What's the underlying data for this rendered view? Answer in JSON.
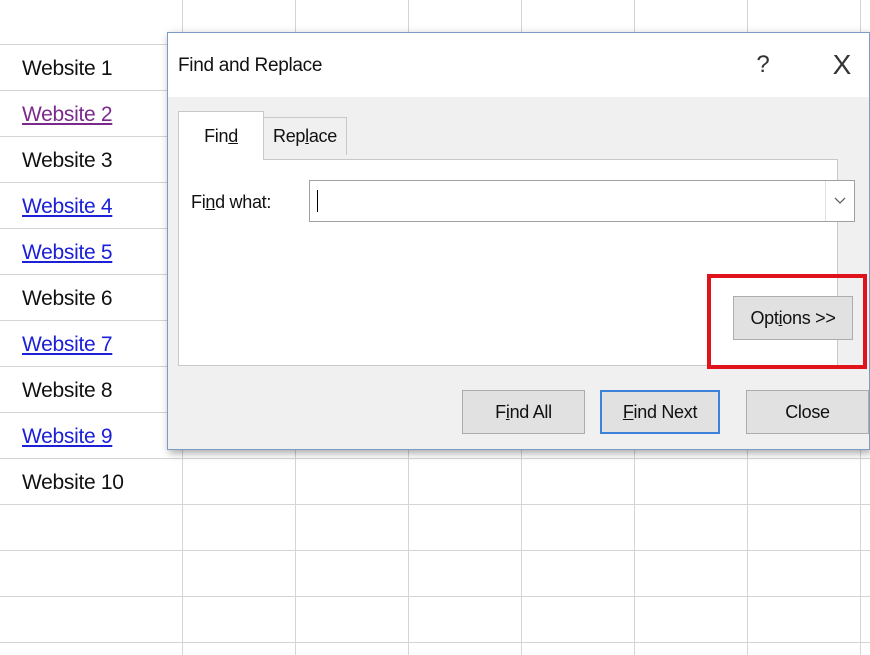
{
  "sheet": {
    "rows": [
      {
        "text": "Website 1",
        "style": "plain"
      },
      {
        "text": "Website 2",
        "style": "visited"
      },
      {
        "text": "Website 3",
        "style": "plain"
      },
      {
        "text": "Website 4",
        "style": "link"
      },
      {
        "text": "Website 5",
        "style": "link"
      },
      {
        "text": "Website 6",
        "style": "plain"
      },
      {
        "text": "Website 7",
        "style": "link"
      },
      {
        "text": "Website 8",
        "style": "plain"
      },
      {
        "text": "Website 9",
        "style": "link"
      },
      {
        "text": "Website 10",
        "style": "plain"
      }
    ],
    "colors": {
      "link": "#1c20d6",
      "visited": "#7b2a8c",
      "text": "#111111",
      "grid": "#d4d4d4"
    }
  },
  "dialog": {
    "title": "Find and Replace",
    "help_label": "?",
    "close_x_label": "X",
    "tabs": [
      {
        "pre": "Fin",
        "ul": "d",
        "post": "",
        "selected": true
      },
      {
        "pre": "Rep",
        "ul": "l",
        "post": "ace",
        "selected": false
      }
    ],
    "find_what": {
      "pre": "Fi",
      "ul": "n",
      "post": "d what:"
    },
    "find_input": {
      "value": "",
      "placeholder": ""
    },
    "dropdown_icon": "chevron-down-icon",
    "buttons": {
      "options": {
        "pre": "Opt",
        "ul": "i",
        "post": "ons >>"
      },
      "find_all": {
        "pre": "F",
        "ul": "i",
        "post": "nd All"
      },
      "find_next": {
        "pre": "",
        "ul": "F",
        "post": "ind Next"
      },
      "close": {
        "label": "Close"
      }
    }
  },
  "annotation": {
    "highlight_color": "#e0121b",
    "target": "options-button"
  }
}
